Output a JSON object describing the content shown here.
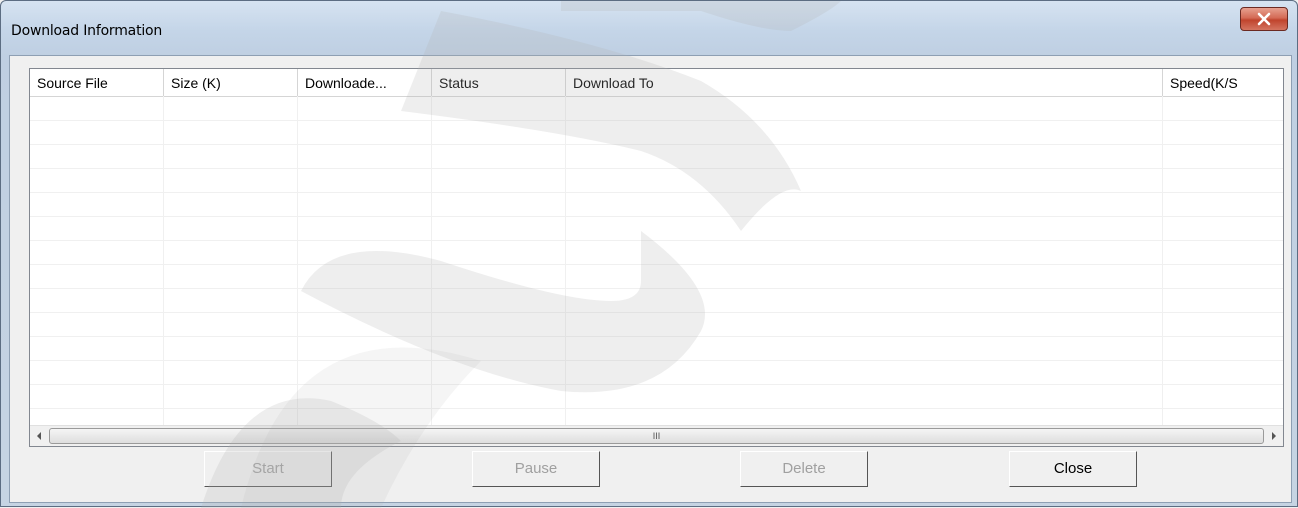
{
  "window": {
    "title": "Download Information",
    "close_icon": "close-x-icon"
  },
  "table": {
    "columns": [
      "Source File",
      "Size (K)",
      "Downloade...",
      "Status",
      "Download To",
      "Speed(K/S"
    ],
    "rows": []
  },
  "scrollbar": {
    "thumb_grip": "III"
  },
  "buttons": {
    "start": "Start",
    "pause": "Pause",
    "delete": "Delete",
    "close": "Close"
  }
}
